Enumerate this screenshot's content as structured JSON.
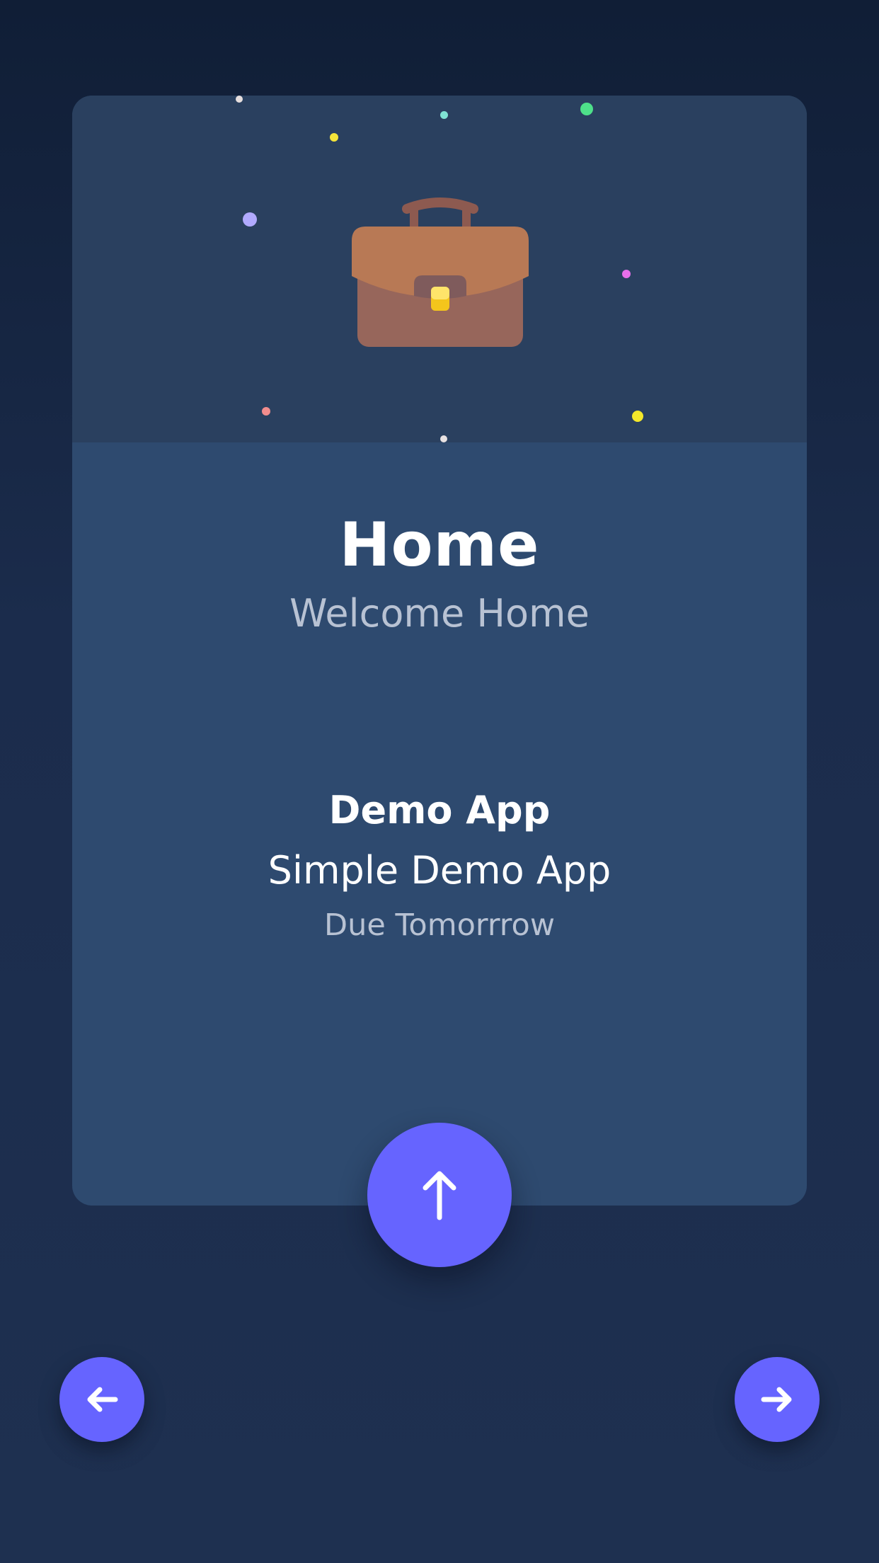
{
  "header": {
    "title": "Home",
    "subtitle": "Welcome Home"
  },
  "hero": {
    "icon": "briefcase-icon"
  },
  "app": {
    "name": "Demo App",
    "description": "Simple Demo App",
    "due": "Due Tomorrrow"
  },
  "actions": {
    "up_icon": "arrow-up-icon",
    "prev_icon": "arrow-left-icon",
    "next_icon": "arrow-right-icon"
  },
  "colors": {
    "background": "#14233f",
    "card": "#2e4a6f",
    "card_header": "#2a405f",
    "accent": "#6664ff",
    "text_primary": "#ffffff",
    "text_secondary": "#b8c2d3"
  }
}
